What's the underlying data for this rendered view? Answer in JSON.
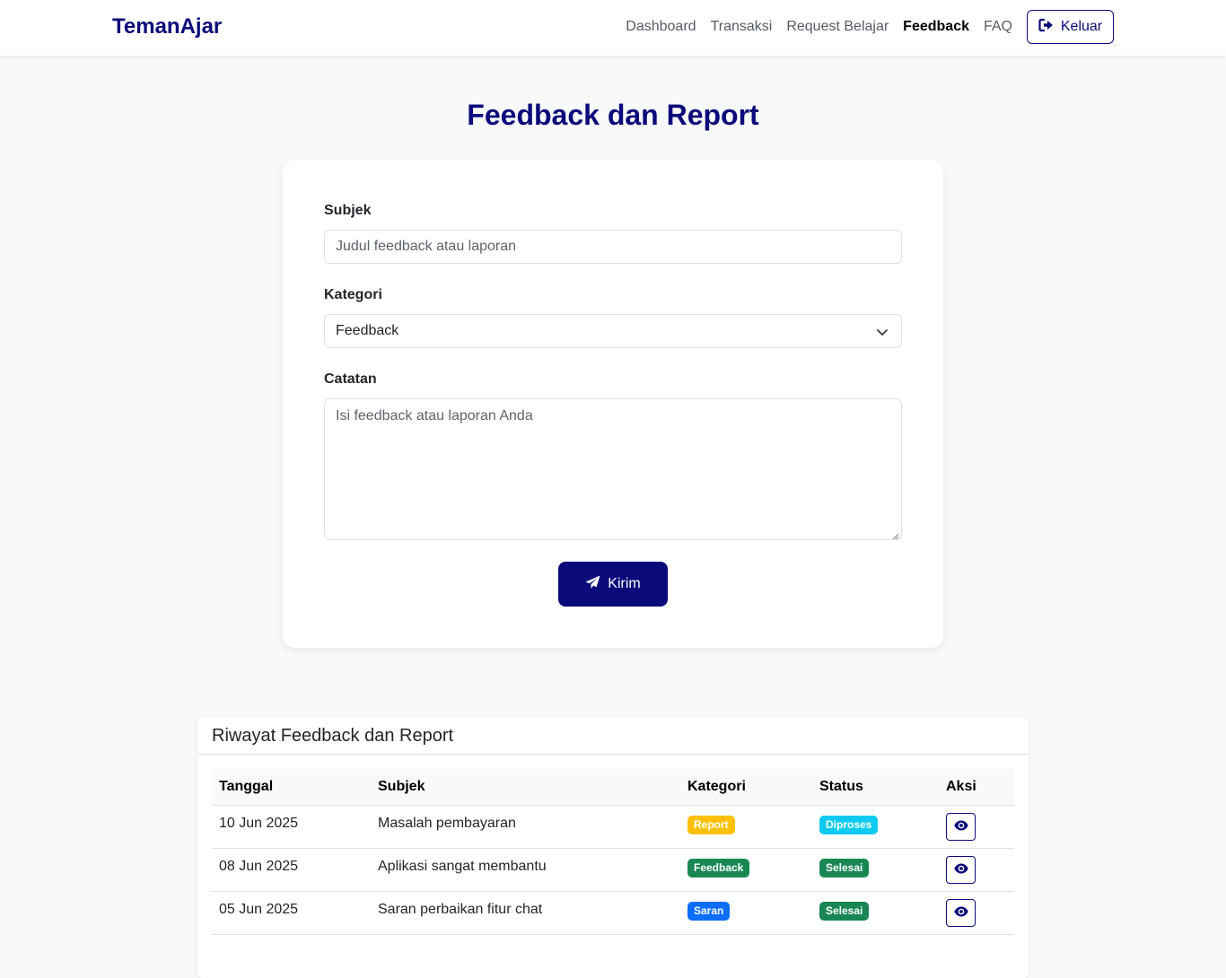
{
  "navbar": {
    "brand": "TemanAjar",
    "links": [
      {
        "label": "Dashboard"
      },
      {
        "label": "Transaksi"
      },
      {
        "label": "Request Belajar"
      },
      {
        "label": "Feedback"
      },
      {
        "label": "FAQ"
      }
    ],
    "active_link": "Feedback",
    "logout_label": "Keluar",
    "logout_icon": "sign-out-icon"
  },
  "page": {
    "title": "Feedback dan Report"
  },
  "form": {
    "subject_label": "Subjek",
    "subject_placeholder": "Judul feedback atau laporan",
    "subject_value": "",
    "category_label": "Kategori",
    "category_selected": "Feedback",
    "notes_label": "Catatan",
    "notes_placeholder": "Isi feedback atau laporan Anda",
    "notes_value": "",
    "submit_label": "Kirim",
    "submit_icon": "paper-plane-icon"
  },
  "history": {
    "title": "Riwayat Feedback dan Report",
    "columns": [
      "Tanggal",
      "Subjek",
      "Kategori",
      "Status",
      "Aksi"
    ],
    "rows": [
      {
        "date": "10 Jun 2025",
        "subject": "Masalah pembayaran",
        "category": "Report",
        "category_color": "#ffc107",
        "status": "Diproses",
        "status_color": "#0dcaf0",
        "action_icon": "eye-icon"
      },
      {
        "date": "08 Jun 2025",
        "subject": "Aplikasi sangat membantu",
        "category": "Feedback",
        "category_color": "#198754",
        "status": "Selesai",
        "status_color": "#198754",
        "action_icon": "eye-icon"
      },
      {
        "date": "05 Jun 2025",
        "subject": "Saran perbaikan fitur chat",
        "category": "Saran",
        "category_color": "#0d6efd",
        "status": "Selesai",
        "status_color": "#198754",
        "action_icon": "eye-icon"
      }
    ]
  },
  "colors": {
    "primary": "#0a0a7a",
    "background": "#f8f9fa"
  }
}
